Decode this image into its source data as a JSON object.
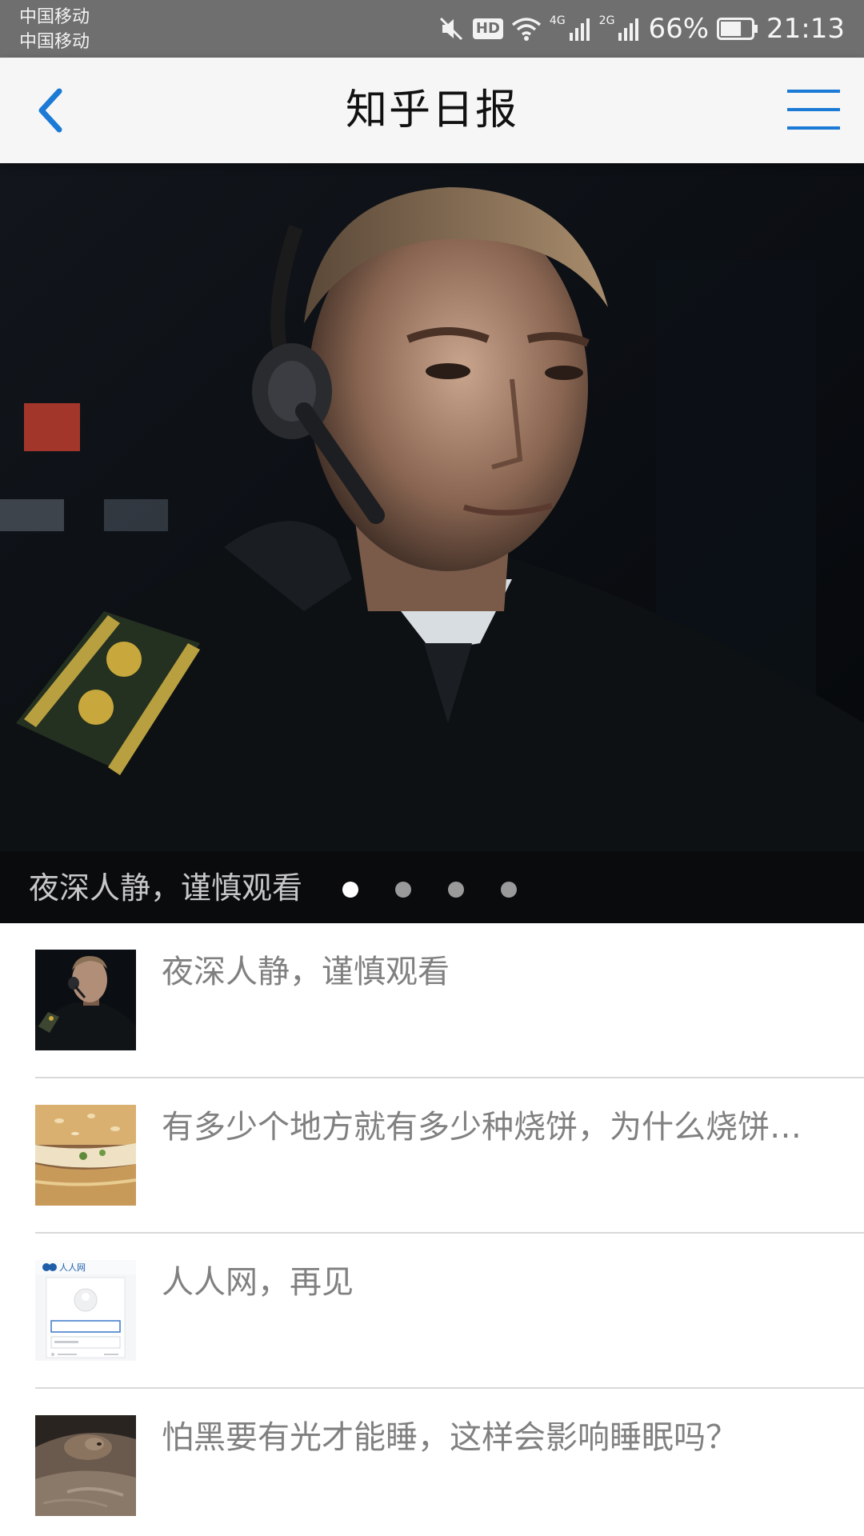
{
  "status_bar": {
    "carrier_1": "中国移动",
    "carrier_2": "中国移动",
    "hd": "HD",
    "net_1": "4G",
    "net_2": "2G",
    "battery": "66%",
    "time": "21:13",
    "battery_level": 0.66,
    "icons": [
      "mute-icon",
      "hd-icon",
      "wifi-icon",
      "signal-4g-icon",
      "signal-2g-icon",
      "battery-icon"
    ]
  },
  "header": {
    "title": "知乎日报",
    "back_icon": "chevron-left-icon",
    "menu_icon": "hamburger-menu-icon",
    "accent_color": "#1a7ad6"
  },
  "hero": {
    "caption": "夜深人静，谨慎观看",
    "dots_total": 4,
    "active_dot": 1
  },
  "news": [
    {
      "title": "夜深人静，谨慎观看",
      "thumb": "man-with-headset-thumb"
    },
    {
      "title": "有多少个地方就有多少种烧饼，为什么烧饼…",
      "thumb": "flatbread-thumb"
    },
    {
      "title": "人人网，再见",
      "thumb": "renren-login-thumb",
      "thumb_text": "人人网"
    },
    {
      "title": "怕黑要有光才能睡，这样会影响睡眠吗？",
      "thumb": "sleeping-dog-thumb"
    }
  ]
}
